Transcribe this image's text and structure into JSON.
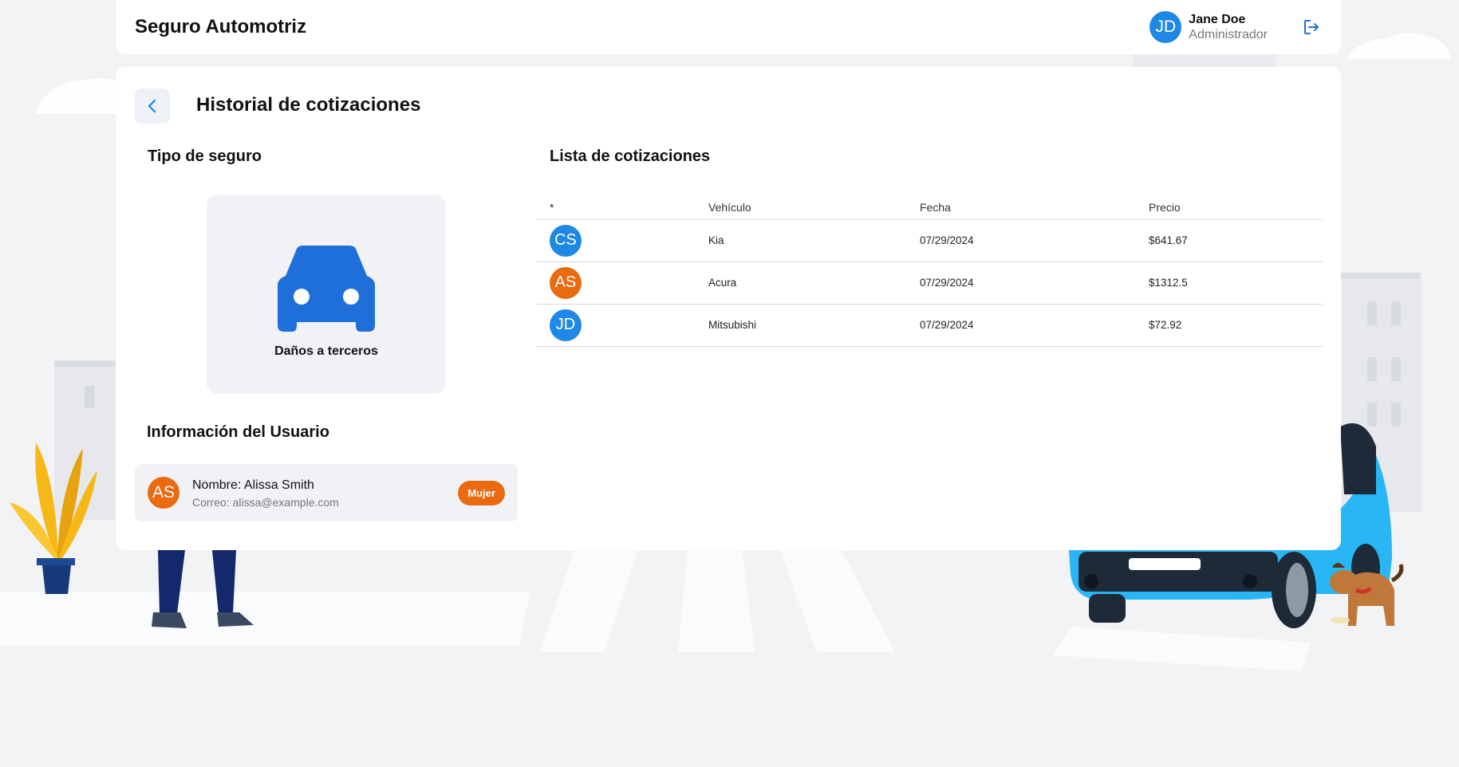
{
  "header": {
    "app_title": "Seguro Automotriz",
    "user": {
      "initials": "JD",
      "name": "Jane Doe",
      "role": "Administrador"
    },
    "logout_icon": "logout-icon"
  },
  "page": {
    "back_icon": "chevron-left-icon",
    "title": "Historial de cotizaciones"
  },
  "insurance_type": {
    "section_title": "Tipo de seguro",
    "icon": "car-icon",
    "label": "Daños a terceros"
  },
  "user_info": {
    "section_title": "Información del Usuario",
    "initials": "AS",
    "name_line": "Nombre: Alissa Smith",
    "email_line": "Correo: alissa@example.com",
    "gender_badge": "Mujer"
  },
  "quotes": {
    "section_title": "Lista de cotizaciones",
    "columns": [
      "*",
      "Vehículo",
      "Fecha",
      "Precio"
    ],
    "rows": [
      {
        "initials": "CS",
        "vehicle": "Kia",
        "date": "07/29/2024",
        "price": "$641.67",
        "avatar_color": "#1e88e5"
      },
      {
        "initials": "AS",
        "vehicle": "Acura",
        "date": "07/29/2024",
        "price": "$1312.5",
        "avatar_color": "#ea6a10"
      },
      {
        "initials": "JD",
        "vehicle": "Mitsubishi",
        "date": "07/29/2024",
        "price": "$72.92",
        "avatar_color": "#1e88e5"
      }
    ]
  },
  "colors": {
    "accent_blue": "#1e88e5",
    "accent_orange": "#ea6a10",
    "background": "#f2f3f5"
  }
}
